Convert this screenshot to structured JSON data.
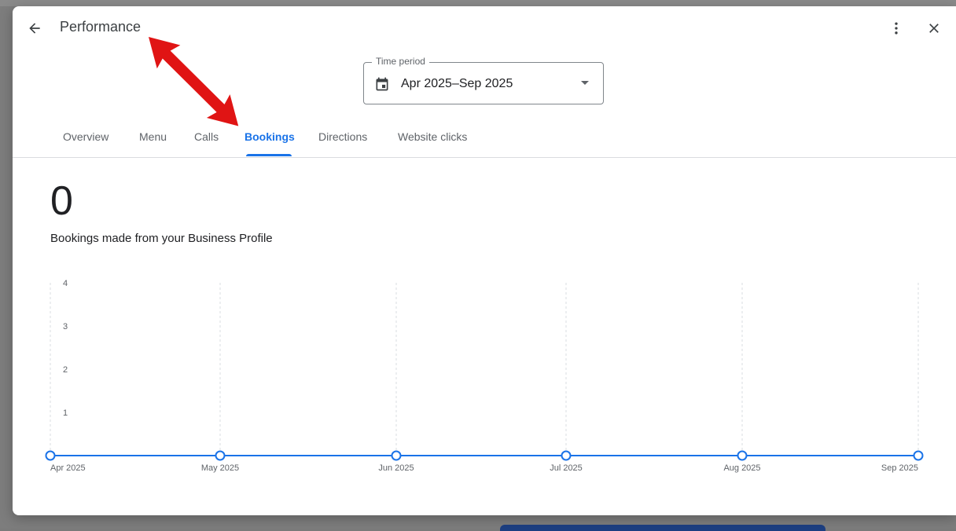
{
  "header": {
    "title": "Performance"
  },
  "time_period": {
    "label": "Time period",
    "value": "Apr 2025–Sep 2025"
  },
  "tabs": [
    {
      "label": "Overview"
    },
    {
      "label": "Menu"
    },
    {
      "label": "Calls"
    },
    {
      "label": "Bookings",
      "active": true
    },
    {
      "label": "Directions"
    },
    {
      "label": "Website clicks"
    }
  ],
  "metric": {
    "value": "0",
    "description": "Bookings made from your Business Profile"
  },
  "colors": {
    "accent": "#1a73e8",
    "annotation_arrow": "#e01414"
  },
  "icons": [
    "back-arrow-icon",
    "calendar-icon",
    "more-vert-icon",
    "close-icon"
  ],
  "chart_data": {
    "type": "line",
    "categories": [
      "Apr 2025",
      "May 2025",
      "Jun 2025",
      "Jul 2025",
      "Aug 2025",
      "Sep 2025"
    ],
    "series": [
      {
        "values": [
          0,
          0,
          0,
          0,
          0,
          0
        ]
      }
    ],
    "yticks": [
      1,
      2,
      3,
      4
    ],
    "ylim": [
      0,
      4
    ],
    "grid": "vertical dashed"
  }
}
